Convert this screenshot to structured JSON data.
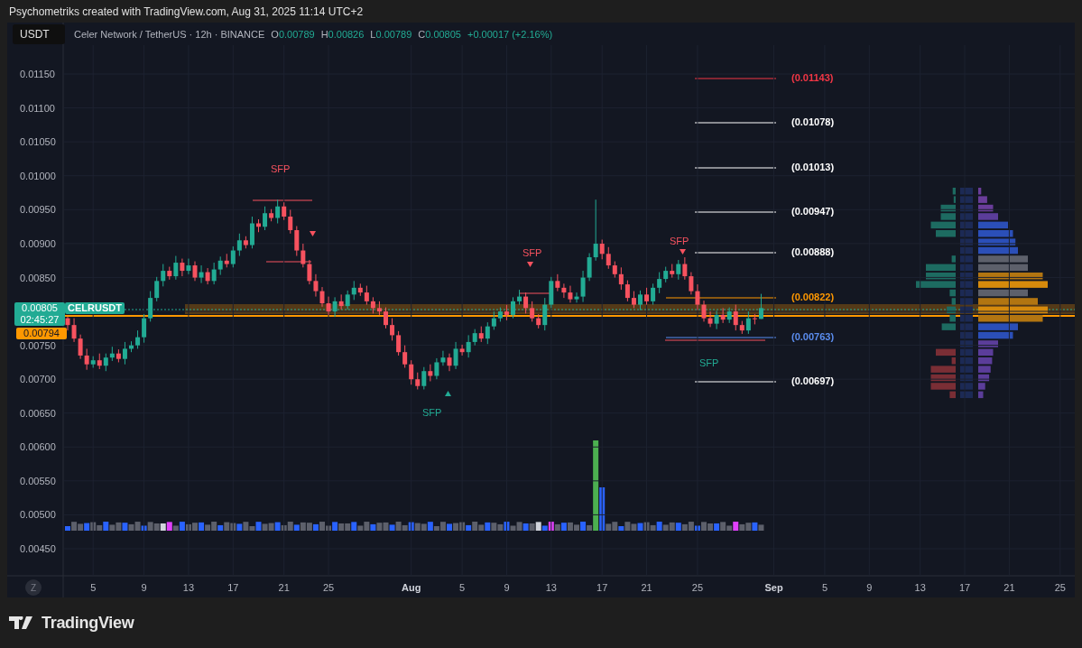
{
  "caption": "Psychometriks created with TradingView.com, Aug 31, 2025 11:14 UTC+2",
  "toolbar": {
    "symbol_button": "USDT"
  },
  "legend": {
    "title": "Celer Network / TetherUS · 12h · BINANCE",
    "ohlc": [
      {
        "label": "O",
        "value": "0.00789"
      },
      {
        "label": "H",
        "value": "0.00826"
      },
      {
        "label": "L",
        "value": "0.00789"
      },
      {
        "label": "C",
        "value": "0.00805"
      }
    ],
    "change": "+0.00017 (+2.16%)"
  },
  "chart": {
    "chart_data": {
      "type": "candlestick",
      "grid": true,
      "ylim": [
        0.0041,
        0.01193
      ],
      "categories": [
        null,
        null,
        null,
        null,
        "5",
        null,
        null,
        null,
        null,
        null,
        null,
        null,
        "9",
        null,
        null,
        null,
        null,
        null,
        null,
        "13",
        null,
        null,
        null,
        null,
        null,
        null,
        "17",
        null,
        null,
        null,
        null,
        null,
        null,
        null,
        "21",
        null,
        null,
        null,
        null,
        null,
        null,
        "25",
        null,
        null,
        null,
        null,
        null,
        null,
        null,
        null,
        null,
        null,
        null,
        null,
        "Aug",
        null,
        null,
        null,
        null,
        null,
        null,
        null,
        "5",
        null,
        null,
        null,
        null,
        null,
        null,
        "9",
        null,
        null,
        null,
        null,
        null,
        null,
        "13",
        null,
        null,
        null,
        null,
        null,
        null,
        null,
        "17",
        null,
        null,
        null,
        null,
        null,
        null,
        "21",
        null,
        null,
        null,
        null,
        null,
        null,
        null,
        "25",
        null,
        null,
        null,
        null,
        null,
        null,
        null,
        null,
        null,
        null,
        null,
        "Sep",
        null,
        null,
        null,
        null,
        null,
        null,
        null,
        "5",
        null,
        null,
        null,
        null,
        null,
        null,
        "9",
        null,
        null,
        null,
        null,
        null,
        null,
        null,
        "13",
        null,
        null,
        null,
        null,
        null,
        null,
        "17",
        null,
        null,
        null,
        null,
        null,
        null,
        "21",
        null,
        null,
        null,
        null,
        null,
        null,
        null,
        "25"
      ],
      "ohlc": [
        [
          0.0079,
          0.00792,
          0.00772,
          0.0078
        ],
        [
          0.0078,
          0.0079,
          0.00755,
          0.0076
        ],
        [
          0.0076,
          0.00766,
          0.0073,
          0.00735
        ],
        [
          0.00735,
          0.00745,
          0.00714,
          0.00722
        ],
        [
          0.00722,
          0.00734,
          0.00717,
          0.00728
        ],
        [
          0.00728,
          0.00738,
          0.00715,
          0.0072
        ],
        [
          0.0072,
          0.00738,
          0.00712,
          0.00732
        ],
        [
          0.00732,
          0.00748,
          0.00727,
          0.00738
        ],
        [
          0.00738,
          0.00744,
          0.00725,
          0.0073
        ],
        [
          0.0073,
          0.00755,
          0.00722,
          0.00745
        ],
        [
          0.00745,
          0.00756,
          0.0074,
          0.0075
        ],
        [
          0.0075,
          0.00772,
          0.00745,
          0.00762
        ],
        [
          0.00762,
          0.00796,
          0.00754,
          0.0079
        ],
        [
          0.0079,
          0.0083,
          0.00785,
          0.0082
        ],
        [
          0.0082,
          0.00851,
          0.00815,
          0.00845
        ],
        [
          0.00845,
          0.0087,
          0.00837,
          0.0086
        ],
        [
          0.0086,
          0.00866,
          0.00847,
          0.00852
        ],
        [
          0.00852,
          0.00882,
          0.00847,
          0.00872
        ],
        [
          0.00872,
          0.00878,
          0.00852,
          0.0086
        ],
        [
          0.0086,
          0.00878,
          0.00855,
          0.00868
        ],
        [
          0.00868,
          0.00874,
          0.00845,
          0.0085
        ],
        [
          0.0085,
          0.00868,
          0.00842,
          0.00858
        ],
        [
          0.00858,
          0.00864,
          0.0084,
          0.00845
        ],
        [
          0.00845,
          0.00872,
          0.0084,
          0.00862
        ],
        [
          0.00862,
          0.00881,
          0.00854,
          0.00875
        ],
        [
          0.00875,
          0.00885,
          0.00865,
          0.0087
        ],
        [
          0.0087,
          0.00896,
          0.00865,
          0.0089
        ],
        [
          0.0089,
          0.00915,
          0.00882,
          0.00905
        ],
        [
          0.00905,
          0.00911,
          0.00893,
          0.00898
        ],
        [
          0.00898,
          0.0094,
          0.00893,
          0.0093
        ],
        [
          0.0093,
          0.00936,
          0.00917,
          0.00925
        ],
        [
          0.00925,
          0.00955,
          0.0092,
          0.00945
        ],
        [
          0.00945,
          0.00951,
          0.00933,
          0.00938
        ],
        [
          0.00938,
          0.00965,
          0.0093,
          0.00955
        ],
        [
          0.00955,
          0.00961,
          0.00935,
          0.0094
        ],
        [
          0.0094,
          0.0095,
          0.00915,
          0.0092
        ],
        [
          0.0092,
          0.00926,
          0.00882,
          0.0089
        ],
        [
          0.0089,
          0.009,
          0.00865,
          0.0087
        ],
        [
          0.0087,
          0.00876,
          0.0084,
          0.00845
        ],
        [
          0.00845,
          0.00855,
          0.00822,
          0.0083
        ],
        [
          0.0083,
          0.00836,
          0.00807,
          0.00812
        ],
        [
          0.00812,
          0.00822,
          0.00795,
          0.008
        ],
        [
          0.008,
          0.00821,
          0.00792,
          0.00815
        ],
        [
          0.00815,
          0.00825,
          0.00803,
          0.00808
        ],
        [
          0.00808,
          0.00831,
          0.00803,
          0.00825
        ],
        [
          0.00825,
          0.00845,
          0.00817,
          0.00835
        ],
        [
          0.00835,
          0.00841,
          0.00823,
          0.00828
        ],
        [
          0.00828,
          0.00838,
          0.0081,
          0.00815
        ],
        [
          0.00815,
          0.00821,
          0.00797,
          0.00805
        ],
        [
          0.00805,
          0.00815,
          0.00795,
          0.008
        ],
        [
          0.008,
          0.00806,
          0.00775,
          0.0078
        ],
        [
          0.0078,
          0.0079,
          0.00757,
          0.00765
        ],
        [
          0.00765,
          0.00771,
          0.00735,
          0.0074
        ],
        [
          0.0074,
          0.0075,
          0.00717,
          0.00722
        ],
        [
          0.00722,
          0.00728,
          0.00692,
          0.007
        ],
        [
          0.007,
          0.0071,
          0.00685,
          0.0069
        ],
        [
          0.0069,
          0.00718,
          0.00685,
          0.00712
        ],
        [
          0.00712,
          0.00722,
          0.00697,
          0.00705
        ],
        [
          0.00705,
          0.00731,
          0.007,
          0.00725
        ],
        [
          0.00725,
          0.00742,
          0.0072,
          0.00732
        ],
        [
          0.00732,
          0.00738,
          0.00712,
          0.0072
        ],
        [
          0.0072,
          0.00755,
          0.00715,
          0.00745
        ],
        [
          0.00745,
          0.00751,
          0.00735,
          0.0074
        ],
        [
          0.0074,
          0.00765,
          0.00732,
          0.00755
        ],
        [
          0.00755,
          0.00774,
          0.0075,
          0.00768
        ],
        [
          0.00768,
          0.00778,
          0.00755,
          0.0076
        ],
        [
          0.0076,
          0.00784,
          0.00752,
          0.00778
        ],
        [
          0.00778,
          0.008,
          0.00773,
          0.0079
        ],
        [
          0.0079,
          0.00806,
          0.00785,
          0.008
        ],
        [
          0.008,
          0.0081,
          0.00787,
          0.00795
        ],
        [
          0.00795,
          0.00821,
          0.0079,
          0.00815
        ],
        [
          0.00815,
          0.00832,
          0.0081,
          0.00822
        ],
        [
          0.00822,
          0.00828,
          0.00797,
          0.00805
        ],
        [
          0.00805,
          0.00815,
          0.00785,
          0.0079
        ],
        [
          0.0079,
          0.00796,
          0.00775,
          0.0078
        ],
        [
          0.0078,
          0.0082,
          0.00772,
          0.0081
        ],
        [
          0.0081,
          0.00851,
          0.00805,
          0.00845
        ],
        [
          0.00845,
          0.00855,
          0.0083,
          0.00835
        ],
        [
          0.00835,
          0.00841,
          0.0082,
          0.00828
        ],
        [
          0.00828,
          0.00838,
          0.00813,
          0.00818
        ],
        [
          0.00818,
          0.00828,
          0.00813,
          0.00822
        ],
        [
          0.00822,
          0.0086,
          0.00814,
          0.0085
        ],
        [
          0.0085,
          0.00886,
          0.00845,
          0.0088
        ],
        [
          0.0088,
          0.00965,
          0.00875,
          0.009
        ],
        [
          0.009,
          0.00906,
          0.00877,
          0.00885
        ],
        [
          0.00885,
          0.00895,
          0.00863,
          0.00868
        ],
        [
          0.00868,
          0.00874,
          0.0085,
          0.00855
        ],
        [
          0.00855,
          0.00865,
          0.00832,
          0.0084
        ],
        [
          0.0084,
          0.00846,
          0.00815,
          0.0082
        ],
        [
          0.0082,
          0.0083,
          0.00805,
          0.0081
        ],
        [
          0.0081,
          0.00831,
          0.00802,
          0.00825
        ],
        [
          0.00825,
          0.00835,
          0.0081,
          0.00815
        ],
        [
          0.00815,
          0.00841,
          0.0081,
          0.00835
        ],
        [
          0.00835,
          0.00858,
          0.00827,
          0.00848
        ],
        [
          0.00848,
          0.00866,
          0.00843,
          0.0086
        ],
        [
          0.0086,
          0.0087,
          0.0085,
          0.00855
        ],
        [
          0.00855,
          0.00876,
          0.00847,
          0.0087
        ],
        [
          0.0087,
          0.0088,
          0.00847,
          0.00852
        ],
        [
          0.00852,
          0.00858,
          0.00825,
          0.0083
        ],
        [
          0.0083,
          0.0084,
          0.00802,
          0.0081
        ],
        [
          0.0081,
          0.00816,
          0.00785,
          0.0079
        ],
        [
          0.0079,
          0.008,
          0.00777,
          0.00782
        ],
        [
          0.00782,
          0.00801,
          0.00774,
          0.00795
        ],
        [
          0.00795,
          0.00805,
          0.00783,
          0.00788
        ],
        [
          0.00788,
          0.00806,
          0.00783,
          0.008
        ],
        [
          0.008,
          0.0081,
          0.00772,
          0.0078
        ],
        [
          0.0078,
          0.00786,
          0.00767,
          0.00772
        ],
        [
          0.00772,
          0.008,
          0.00767,
          0.0079
        ],
        [
          0.0079,
          0.00796,
          0.00781,
          0.00789
        ],
        [
          0.00789,
          0.00826,
          0.00789,
          0.00805
        ],
        null,
        null,
        null,
        null,
        null,
        null,
        null,
        null,
        null,
        null,
        null,
        null,
        null,
        null,
        null,
        null,
        null,
        null,
        null,
        null,
        null,
        null,
        null,
        null,
        null,
        null,
        null,
        null,
        null,
        null,
        null,
        null,
        null,
        null,
        null,
        null,
        null,
        null,
        null,
        null,
        null,
        null,
        null,
        null,
        null,
        null,
        null
      ],
      "yticks": [
        {
          "value": 0.0115,
          "label": "0.01150"
        },
        {
          "value": 0.011,
          "label": "0.01100"
        },
        {
          "value": 0.0105,
          "label": "0.01050"
        },
        {
          "value": 0.01,
          "label": "0.01000"
        },
        {
          "value": 0.0095,
          "label": "0.00950"
        },
        {
          "value": 0.009,
          "label": "0.00900"
        },
        {
          "value": 0.0085,
          "label": "0.00850"
        },
        {
          "value": 0.0075,
          "label": "0.00750"
        },
        {
          "value": 0.007,
          "label": "0.00700"
        },
        {
          "value": 0.0065,
          "label": "0.00650"
        },
        {
          "value": 0.006,
          "label": "0.00600"
        },
        {
          "value": 0.0055,
          "label": "0.00550"
        },
        {
          "value": 0.005,
          "label": "0.00500"
        },
        {
          "value": 0.0045,
          "label": "0.00450"
        }
      ]
    }
  },
  "price_tags": [
    {
      "kind": "last",
      "price": "0.00805",
      "countdown": "02:45:27",
      "symbol": "CELRUSDT"
    },
    {
      "kind": "level",
      "price": "0.00794"
    }
  ],
  "levels": [
    {
      "label": "(0.01143)",
      "color": "#f23645"
    },
    {
      "label": "(0.01078)",
      "color": "#ffffff"
    },
    {
      "label": "(0.01013)",
      "color": "#ffffff"
    },
    {
      "label": "(0.00947)",
      "color": "#ffffff"
    },
    {
      "label": "(0.00888)",
      "color": "#ffffff"
    },
    {
      "label": "(0.00822)",
      "color": "#ff9800"
    },
    {
      "label": "(0.00763)",
      "color": "#5b8def"
    },
    {
      "label": "(0.00697)",
      "color": "#ffffff"
    }
  ],
  "sfp_labels": [
    {
      "text": "SFP",
      "color": "#f7525f"
    },
    {
      "text": "SFP",
      "color": "#f7525f"
    },
    {
      "text": "SFP",
      "color": "#f7525f"
    },
    {
      "text": "SFP",
      "color": "#22ab94"
    },
    {
      "text": "SFP",
      "color": "#22ab94"
    }
  ],
  "time_axis": {
    "scale_button": "Z"
  },
  "footer": {
    "logo_text": "TradingView"
  }
}
